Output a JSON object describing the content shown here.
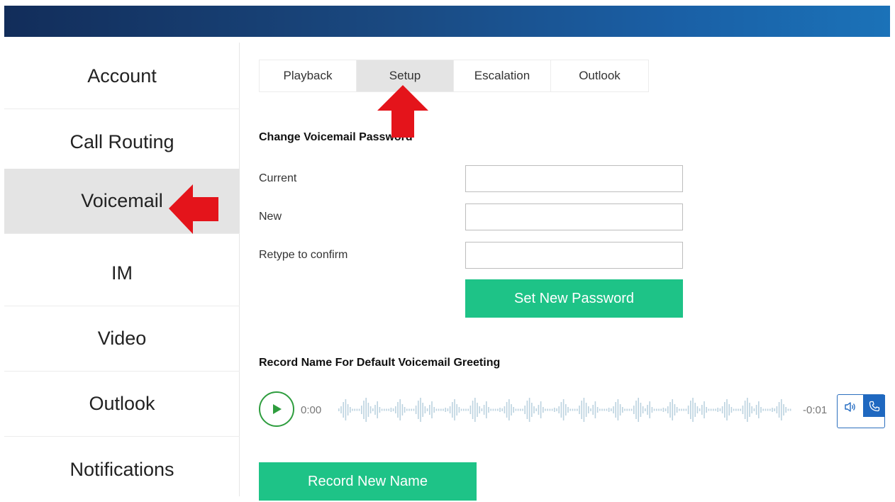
{
  "sidebar": {
    "items": [
      {
        "label": "Account"
      },
      {
        "label": "Call Routing"
      },
      {
        "label": "Voicemail",
        "active": true
      },
      {
        "label": "IM"
      },
      {
        "label": "Video"
      },
      {
        "label": "Outlook"
      },
      {
        "label": "Notifications"
      }
    ]
  },
  "tabs": [
    {
      "label": "Playback"
    },
    {
      "label": "Setup",
      "active": true
    },
    {
      "label": "Escalation"
    },
    {
      "label": "Outlook"
    }
  ],
  "password_section": {
    "title": "Change Voicemail Password",
    "current_label": "Current",
    "current_value": "",
    "new_label": "New",
    "new_value": "",
    "confirm_label": "Retype to confirm",
    "confirm_value": "",
    "submit_label": "Set New Password"
  },
  "greeting_section": {
    "title": "Record Name For Default Voicemail Greeting",
    "elapsed": "0:00",
    "remaining": "-0:01",
    "record_label": "Record New Name"
  },
  "icons": {
    "play": "play-icon",
    "speaker": "speaker-icon",
    "phone": "phone-icon",
    "annotation_arrow": "red-arrow-icon"
  },
  "colors": {
    "banner_start": "#122d5a",
    "banner_end": "#1b72b8",
    "accent_green": "#1ec387",
    "play_green": "#2e9d3e",
    "active_bg": "#e4e4e4",
    "control_blue": "#1f68c0",
    "arrow_red": "#e4141b",
    "waveform": "#bcd3e0"
  }
}
